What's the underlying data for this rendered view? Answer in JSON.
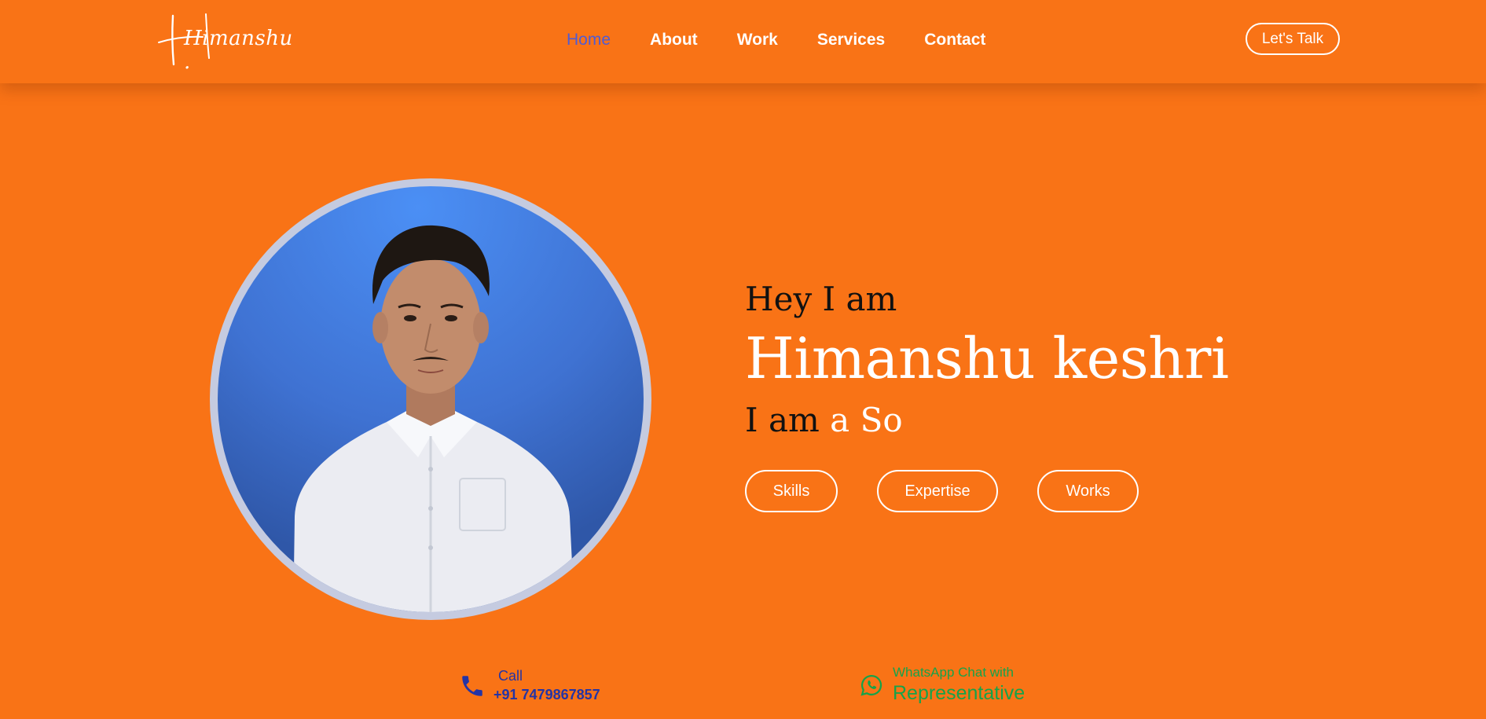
{
  "header": {
    "logo_text": "Himanshu .",
    "nav": [
      {
        "label": "Home",
        "active": true
      },
      {
        "label": "About"
      },
      {
        "label": "Work"
      },
      {
        "label": "Services"
      },
      {
        "label": "Contact"
      }
    ],
    "cta_label": "Let's Talk"
  },
  "hero": {
    "greeting": "Hey I am",
    "name": "Himanshu keshri",
    "role_prefix": "I am",
    "role_typed": "a So",
    "buttons": [
      "Skills",
      "Expertise",
      "Works"
    ]
  },
  "contact": {
    "call_label": "Call",
    "call_number": "+91 7479867857",
    "whatsapp_label": "WhatsApp Chat with",
    "whatsapp_target": "Representative"
  },
  "colors": {
    "background": "#f97316",
    "active_nav": "#4f5bd5",
    "call_text": "#2434a6",
    "whatsapp_green": "#16a34a"
  },
  "icons": {
    "call": "phone-icon",
    "whatsapp": "whatsapp-icon"
  }
}
